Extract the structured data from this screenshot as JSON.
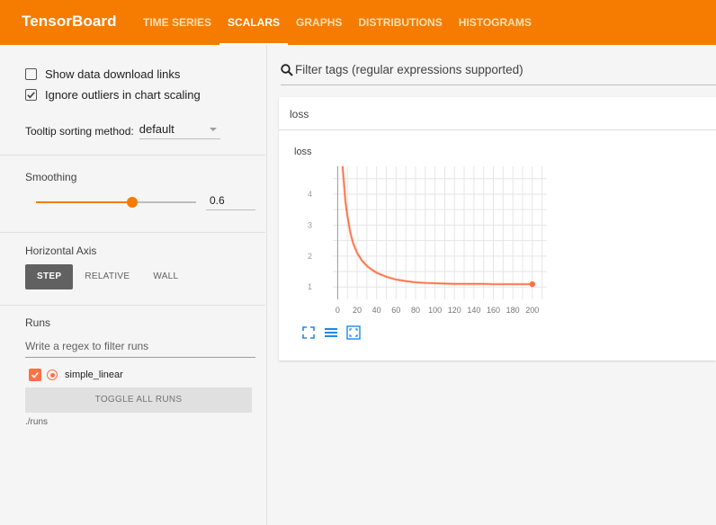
{
  "header": {
    "brand": "TensorBoard",
    "tabs": [
      {
        "label": "TIME SERIES",
        "active": false
      },
      {
        "label": "SCALARS",
        "active": true
      },
      {
        "label": "GRAPHS",
        "active": false
      },
      {
        "label": "DISTRIBUTIONS",
        "active": false
      },
      {
        "label": "HISTOGRAMS",
        "active": false
      }
    ],
    "color": "#f57c00"
  },
  "sidebar": {
    "options": [
      {
        "label": "Show data download links",
        "checked": false
      },
      {
        "label": "Ignore outliers in chart scaling",
        "checked": true
      }
    ],
    "tooltip_sorting": {
      "label": "Tooltip sorting method:",
      "value": "default"
    },
    "smoothing": {
      "label": "Smoothing",
      "value": "0.6",
      "fraction": 0.6
    },
    "horizontal_axis": {
      "label": "Horizontal Axis",
      "options": [
        {
          "label": "STEP",
          "active": true
        },
        {
          "label": "RELATIVE",
          "active": false
        },
        {
          "label": "WALL",
          "active": false
        }
      ]
    },
    "runs": {
      "label": "Runs",
      "filter_placeholder": "Write a regex to filter runs",
      "items": [
        {
          "name": "simple_linear",
          "checked": true,
          "color": "#ff7043"
        }
      ],
      "toggle_label": "TOGGLE ALL RUNS",
      "path": "./runs"
    }
  },
  "main": {
    "filter_placeholder": "Filter tags (regular expressions supported)",
    "card": {
      "tag": "loss",
      "chart_title": "loss"
    },
    "tools": [
      "fit-domain-icon",
      "toggle-log-scale-icon",
      "toggle-y-axis-icon"
    ]
  },
  "chart_data": {
    "type": "line",
    "title": "loss",
    "xlabel": "",
    "ylabel": "",
    "xlim": [
      -5,
      215
    ],
    "ylim": [
      0.6,
      4.9
    ],
    "x_ticks": [
      "0",
      "20",
      "40",
      "60",
      "80",
      "100",
      "120",
      "140",
      "160",
      "180",
      "200"
    ],
    "y_ticks": [
      "1",
      "2",
      "3",
      "4"
    ],
    "grid": true,
    "series": [
      {
        "color": "#ff7043",
        "x": [
          5,
          8,
          10,
          13,
          16,
          20,
          25,
          30,
          35,
          40,
          50,
          60,
          70,
          80,
          90,
          100,
          110,
          120,
          130,
          140,
          150,
          160,
          170,
          180,
          190,
          200
        ],
        "y": [
          4.9,
          3.75,
          3.3,
          2.75,
          2.4,
          2.1,
          1.85,
          1.68,
          1.56,
          1.46,
          1.33,
          1.24,
          1.19,
          1.15,
          1.13,
          1.12,
          1.11,
          1.1,
          1.1,
          1.1,
          1.1,
          1.09,
          1.09,
          1.09,
          1.09,
          1.09
        ]
      }
    ]
  }
}
